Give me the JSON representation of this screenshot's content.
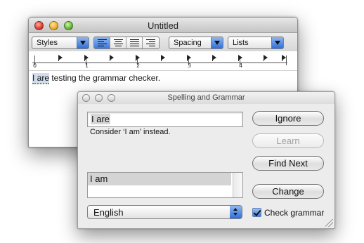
{
  "document_window": {
    "title": "Untitled",
    "toolbar": {
      "styles_label": "Styles",
      "spacing_label": "Spacing",
      "lists_label": "Lists",
      "alignment_buttons": [
        "align-left",
        "align-center",
        "justify",
        "align-right"
      ],
      "active_alignment": "align-left"
    },
    "ruler": {
      "numbers": [
        "0",
        "1",
        "2",
        "3",
        "4"
      ]
    },
    "text": {
      "error_phrase": "I are",
      "rest": " testing the grammar checker."
    }
  },
  "spelling_panel": {
    "title": "Spelling and Grammar",
    "flagged_text": "I are",
    "suggestion_message": "Consider ‘I am’ instead.",
    "guesses": [
      "I am"
    ],
    "language": "English",
    "buttons": {
      "ignore": "Ignore",
      "learn": "Learn",
      "find_next": "Find Next",
      "change": "Change"
    },
    "learn_enabled": false,
    "check_grammar": {
      "label": "Check grammar",
      "checked": true
    }
  },
  "colors": {
    "accent_blue": "#3c79dc",
    "grammar_underline": "#3caa3c",
    "selection": "#d2dcec"
  }
}
